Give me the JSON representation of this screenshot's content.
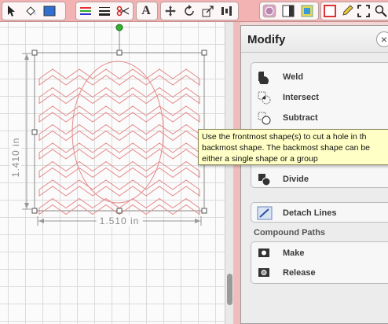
{
  "toolbar": {
    "groups": [
      {
        "name": "select-tools",
        "icons": [
          "pointer-arrow-icon",
          "paint-bucket-icon",
          "fill-color-icon"
        ]
      },
      {
        "name": "line-tools",
        "icons": [
          "line-color-icon",
          "line-style-icon",
          "scissors-icon"
        ]
      },
      {
        "name": "text-tools",
        "icons": [
          "text-icon"
        ]
      },
      {
        "name": "transform-tools",
        "icons": [
          "move-icon",
          "rotate-icon",
          "scale-icon",
          "align-icon"
        ]
      },
      {
        "name": "view-tools",
        "icons": [
          "modify-icon",
          "layers-icon",
          "fill-panel-icon"
        ]
      },
      {
        "name": "misc-tools",
        "icons": [
          "page-border-icon",
          "pencil-icon",
          "fit-page-icon",
          "zoom-icon"
        ]
      }
    ],
    "text_tool_glyph": "A"
  },
  "canvas": {
    "height_label": "1.410 in",
    "width_label": "1.510 in",
    "shape_stroke_color": "#e58a8a"
  },
  "panel": {
    "title": "Modify",
    "close_glyph": "×",
    "shape_ops": [
      {
        "label": "Weld",
        "icon": "weld-icon"
      },
      {
        "label": "Intersect",
        "icon": "intersect-icon"
      },
      {
        "label": "Subtract",
        "icon": "subtract-icon"
      },
      {
        "label": "",
        "icon": "crop-icon"
      },
      {
        "label": "Divide",
        "icon": "divide-icon"
      }
    ],
    "detach_label": "Detach Lines",
    "compound_title": "Compound Paths",
    "compound_ops": [
      {
        "label": "Make",
        "icon": "make-compound-icon"
      },
      {
        "label": "Release",
        "icon": "release-compound-icon"
      }
    ]
  },
  "tooltip": {
    "lines": [
      "Use the frontmost shape(s) to cut a hole in th",
      "backmost shape. The backmost shape can be",
      "either a single shape or a group"
    ]
  }
}
